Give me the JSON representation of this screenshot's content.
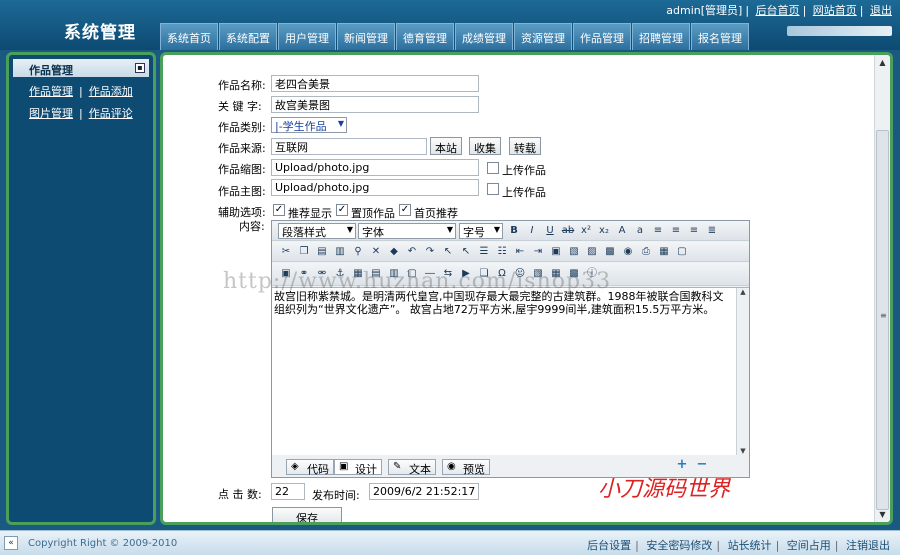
{
  "header": {
    "title": "系统管理",
    "user": "admin[管理员]",
    "links": [
      "后台首页",
      "网站首页",
      "退出"
    ],
    "tabs": [
      "系统首页",
      "系统配置",
      "用户管理",
      "新闻管理",
      "德育管理",
      "成绩管理",
      "资源管理",
      "作品管理",
      "招聘管理",
      "报名管理"
    ]
  },
  "sidebar": {
    "title": "作品管理",
    "rows": [
      [
        "作品管理",
        "作品添加"
      ],
      [
        "图片管理",
        "作品评论"
      ]
    ]
  },
  "form": {
    "name_label": "作品名称:",
    "name_value": "老四合美景",
    "keyword_label": "关 键 字:",
    "keyword_value": "故宫美景图",
    "category_label": "作品类别:",
    "category_value": "|-学生作品",
    "source_label": "作品来源:",
    "source_value": "互联网",
    "source_buttons": [
      "本站",
      "收集",
      "转载"
    ],
    "thumb_label": "作品缩图:",
    "thumb_value": "Upload/photo.jpg",
    "upload_label": "上传作品",
    "main_label": "作品主图:",
    "main_value": "Upload/photo.jpg",
    "options_label": "辅助选项:",
    "options": [
      "推荐显示",
      "置顶作品",
      "首页推荐"
    ],
    "content_label": "内容:",
    "hits_label": "点 击 数:",
    "hits_value": "22",
    "time_label": "发布时间:",
    "time_value": "2009/6/2 21:52:17",
    "save_label": "保存"
  },
  "editor": {
    "paragraph_style": "段落样式",
    "font": "字体",
    "font_size": "字号",
    "content": "故宫旧称紫禁城。是明清两代皇宫,中国现存最大最完整的古建筑群。1988年被联合国教科文组织列为“世界文化遗产”。 故宫占地72万平方米,屋宇9999间半,建筑面积15.5万平方米。",
    "modes": [
      "代码",
      "设计",
      "文本",
      "预览"
    ]
  },
  "watermark": "http://www.huzhan.com/ishop33",
  "brand_mark": "小刀源码世界",
  "footer": {
    "copyright": "Copyright Right © 2009-2010",
    "links": [
      "后台设置",
      "安全密码修改",
      "站长统计",
      "空间占用",
      "注销退出"
    ]
  }
}
